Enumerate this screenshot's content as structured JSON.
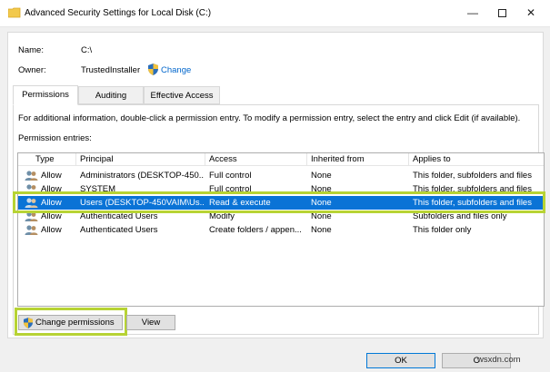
{
  "window": {
    "title": "Advanced Security Settings for Local Disk (C:)",
    "minimize": "—",
    "close": "✕"
  },
  "info": {
    "name_label": "Name:",
    "name_value": "C:\\",
    "owner_label": "Owner:",
    "owner_value": "TrustedInstaller",
    "change_link": "Change"
  },
  "tabs": [
    {
      "label": "Permissions",
      "active": true
    },
    {
      "label": "Auditing",
      "active": false
    },
    {
      "label": "Effective Access",
      "active": false
    }
  ],
  "instructions": "For additional information, double-click a permission entry. To modify a permission entry, select the entry and click Edit (if available).",
  "entries_label": "Permission entries:",
  "table": {
    "columns": [
      "Type",
      "Principal",
      "Access",
      "Inherited from",
      "Applies to"
    ],
    "rows": [
      {
        "type": "Allow",
        "principal": "Administrators (DESKTOP-450...",
        "access": "Full control",
        "inherited": "None",
        "applies": "This folder, subfolders and files",
        "selected": false
      },
      {
        "type": "Allow",
        "principal": "SYSTEM",
        "access": "Full control",
        "inherited": "None",
        "applies": "This folder, subfolders and files",
        "selected": false
      },
      {
        "type": "Allow",
        "principal": "Users (DESKTOP-450VAIM\\Us...",
        "access": "Read & execute",
        "inherited": "None",
        "applies": "This folder, subfolders and files",
        "selected": true
      },
      {
        "type": "Allow",
        "principal": "Authenticated Users",
        "access": "Modify",
        "inherited": "None",
        "applies": "Subfolders and files only",
        "selected": false
      },
      {
        "type": "Allow",
        "principal": "Authenticated Users",
        "access": "Create folders / appen...",
        "inherited": "None",
        "applies": "This folder only",
        "selected": false
      }
    ]
  },
  "buttons": {
    "change_permissions": "Change permissions",
    "view": "View",
    "ok": "OK",
    "cancel": "C"
  },
  "watermark": "wsxdn.com",
  "colors": {
    "selection": "#0a73d6",
    "highlight": "#b7d334",
    "link": "#0066cc"
  }
}
